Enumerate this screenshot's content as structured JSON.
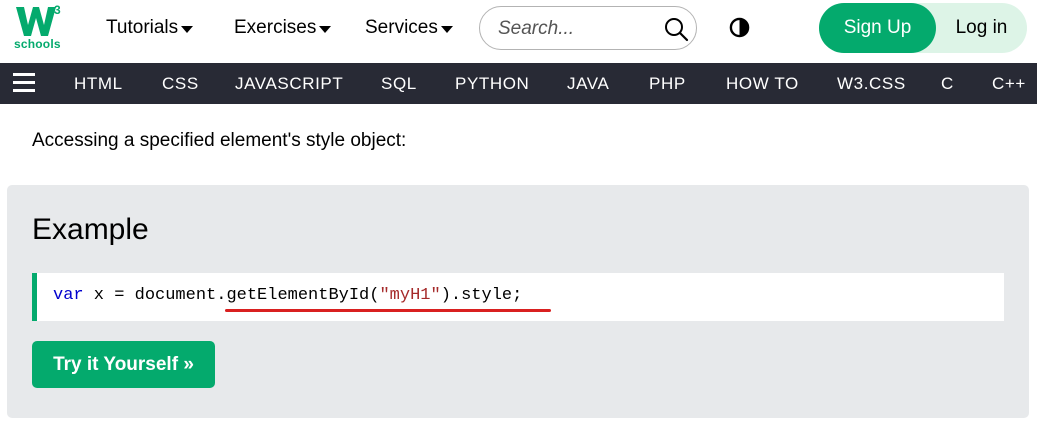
{
  "brand": {
    "logo_mark": "W3",
    "logo_text": "schools",
    "accent_color": "#04AA6D"
  },
  "topnav": {
    "items": [
      {
        "label": "Tutorials"
      },
      {
        "label": "Exercises"
      },
      {
        "label": "Services"
      }
    ],
    "search_placeholder": "Search...",
    "signup_label": "Sign Up",
    "login_label": "Log in"
  },
  "navbar": {
    "background": "#282A35",
    "links": [
      "HTML",
      "CSS",
      "JAVASCRIPT",
      "SQL",
      "PYTHON",
      "JAVA",
      "PHP",
      "HOW TO",
      "W3.CSS",
      "C",
      "C++"
    ]
  },
  "content": {
    "intro": "Accessing a specified element's style object:",
    "example_title": "Example",
    "code": {
      "keyword": "var",
      "pre": " x = document.",
      "method": "getElementById(",
      "string": "\"myH1\"",
      "post": ").style;"
    },
    "try_button": "Try it Yourself »"
  }
}
